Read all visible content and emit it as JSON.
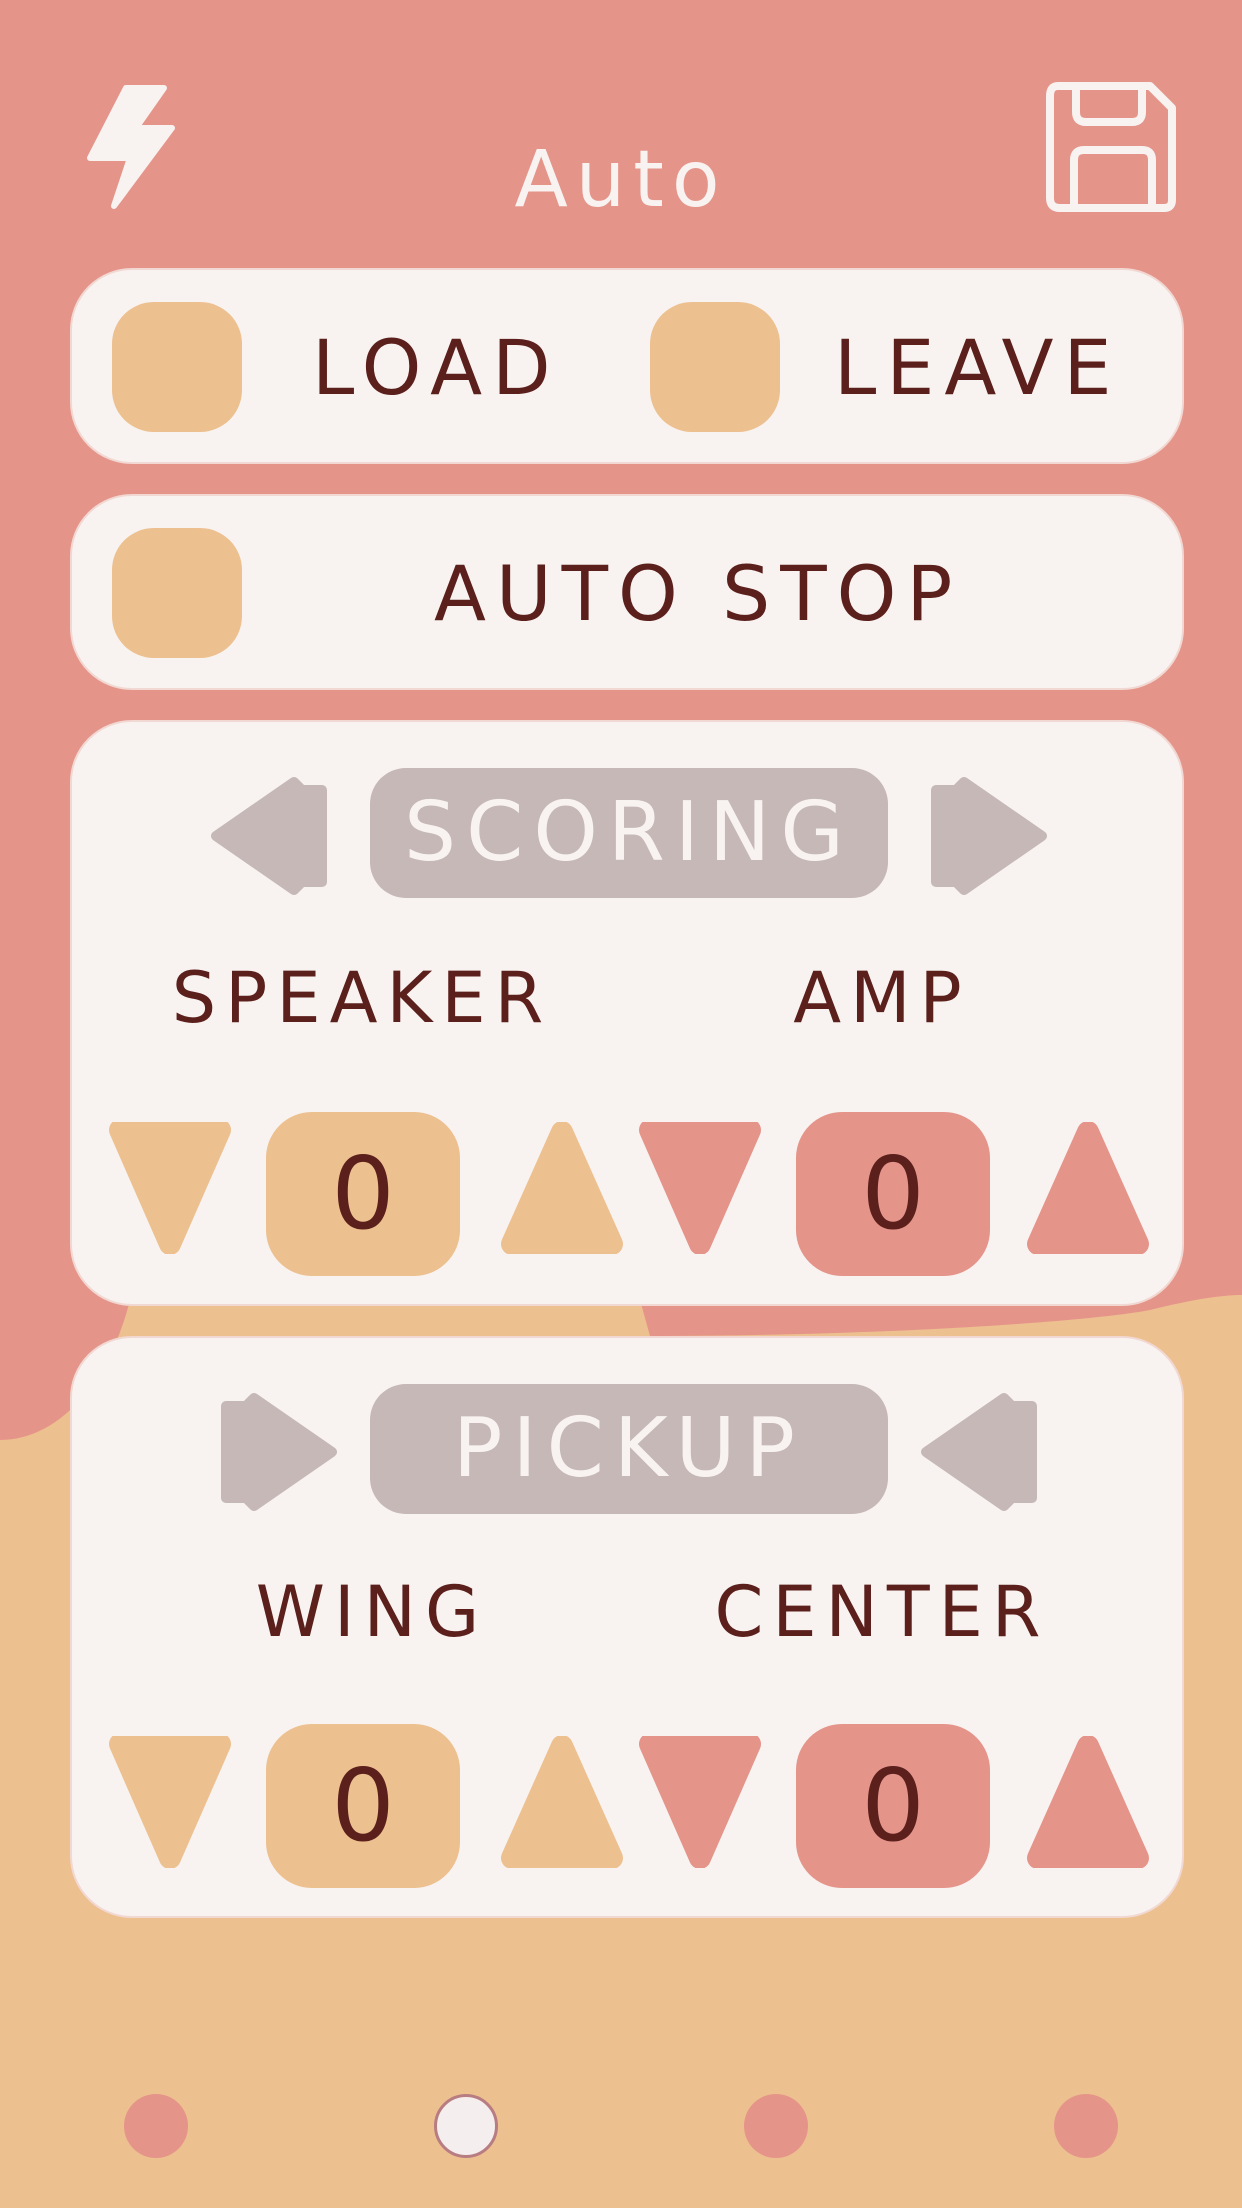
{
  "header": {
    "title": "Auto",
    "left_icon": "lightning-bolt-icon",
    "right_icon": "save-floppy-icon"
  },
  "options": {
    "load_label": "LOAD",
    "leave_label": "LEAVE",
    "auto_stop_label": "AUTO STOP"
  },
  "scoring": {
    "title": "SCORING",
    "left_counter": {
      "label": "SPEAKER",
      "value": "0"
    },
    "right_counter": {
      "label": "AMP",
      "value": "0"
    }
  },
  "pickup": {
    "title": "PICKUP",
    "left_counter": {
      "label": "WING",
      "value": "0"
    },
    "right_counter": {
      "label": "CENTER",
      "value": "0"
    }
  },
  "pager": {
    "page_count": 4,
    "active_index": 1
  },
  "colors": {
    "background_red": "#e5948a",
    "background_orange": "#edc08f",
    "card": "#f8f3f1",
    "text_dark": "#5b1f1c",
    "muted_gray": "#c5b8b6"
  }
}
